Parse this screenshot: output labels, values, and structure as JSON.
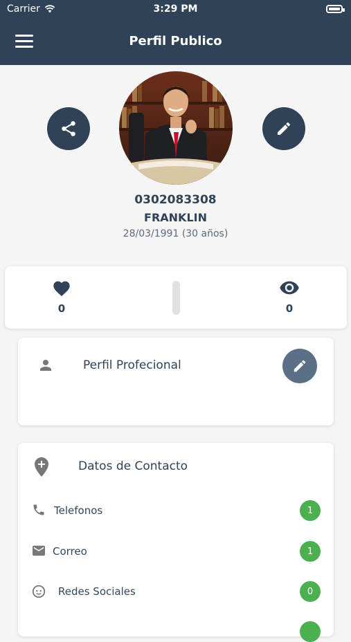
{
  "status_bar": {
    "carrier": "Carrier",
    "time": "3:29 PM"
  },
  "header": {
    "title": "Perfil Publico"
  },
  "profile": {
    "id_number": "0302083308",
    "name": "FRANKLIN",
    "birth": "28/03/1991 (30 años)"
  },
  "stats": {
    "likes": "0",
    "views": "0"
  },
  "professional": {
    "label": "Perfil Profecional"
  },
  "contact": {
    "title": "Datos de Contacto",
    "rows": [
      {
        "label": "Telefonos",
        "count": "1",
        "icon": "phone-icon"
      },
      {
        "label": "Correo",
        "count": "1",
        "icon": "mail-icon"
      },
      {
        "label": "Redes Sociales",
        "count": "0",
        "icon": "face-icon"
      }
    ]
  },
  "colors": {
    "primary": "#2f4257",
    "badge": "#4caf50",
    "edit_button": "#5b7086"
  }
}
